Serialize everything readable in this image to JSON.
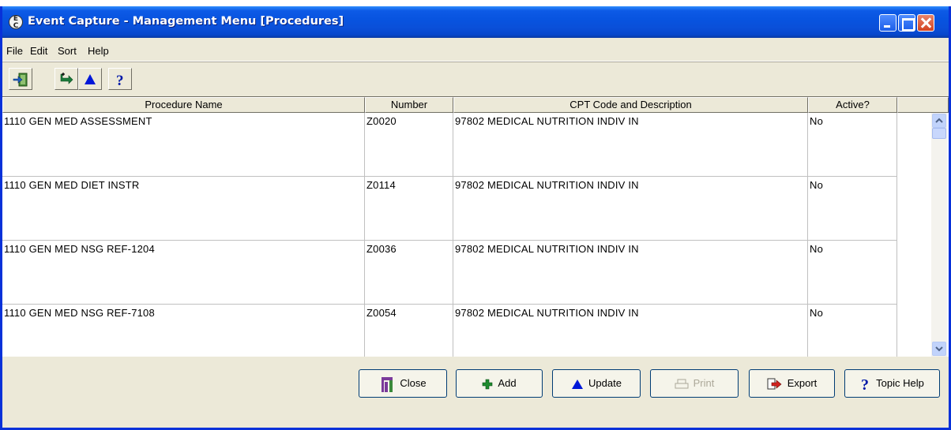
{
  "window": {
    "title": "Event Capture - Management Menu [Procedures]"
  },
  "menu": {
    "items": [
      {
        "label": "File"
      },
      {
        "label": "Edit"
      },
      {
        "label": "Sort"
      },
      {
        "label": "Help"
      }
    ]
  },
  "toolbar": {
    "buttons": [
      {
        "icon": "exit-door-icon"
      },
      {
        "icon": "sort-arrow-icon"
      },
      {
        "icon": "triangle-up-icon"
      },
      {
        "icon": "help-question-icon"
      }
    ]
  },
  "grid": {
    "columns": [
      "Procedure Name",
      "Number",
      "CPT Code and Description",
      "Active?"
    ],
    "rows": [
      {
        "name": "1110 GEN MED ASSESSMENT",
        "number": "Z0020",
        "cpt": "97802  MEDICAL NUTRITION INDIV IN",
        "active": "No"
      },
      {
        "name": "1110 GEN MED DIET INSTR",
        "number": "Z0114",
        "cpt": "97802  MEDICAL NUTRITION INDIV IN",
        "active": "No"
      },
      {
        "name": "1110 GEN MED NSG REF-1204",
        "number": "Z0036",
        "cpt": "97802  MEDICAL NUTRITION INDIV IN",
        "active": "No"
      },
      {
        "name": "1110 GEN MED NSG REF-7108",
        "number": "Z0054",
        "cpt": "97802  MEDICAL NUTRITION INDIV IN",
        "active": "No"
      }
    ]
  },
  "buttons": {
    "close": "Close",
    "add": "Add",
    "update": "Update",
    "print": "Print",
    "export": "Export",
    "topic_help": "Topic Help"
  },
  "colors": {
    "titlebar": "#0a4ad4",
    "face": "#ece9d8",
    "accent_blue": "#0000cc"
  }
}
